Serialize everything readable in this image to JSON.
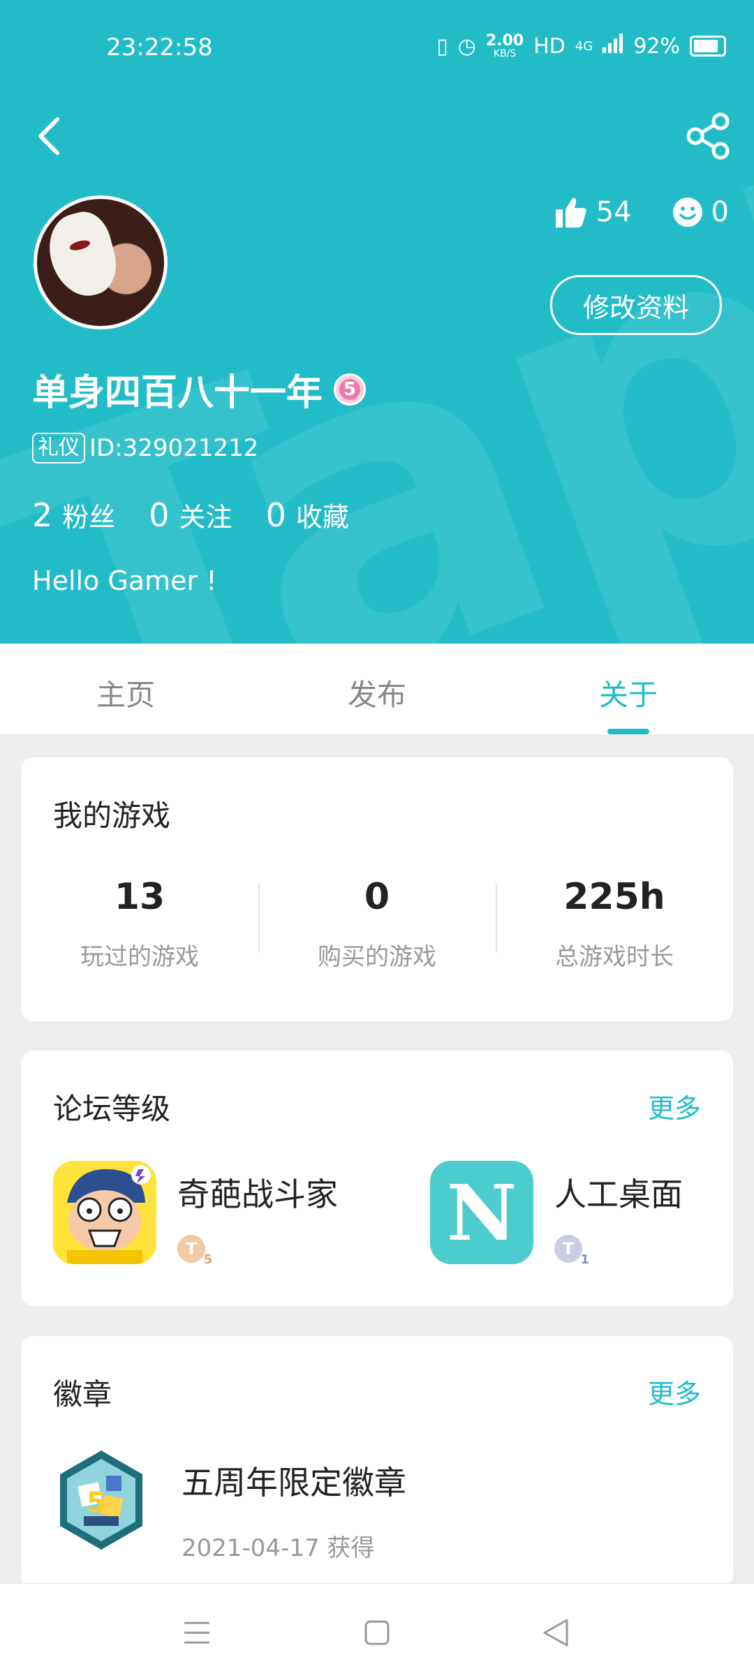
{
  "status_bar": {
    "time": "23:22:58",
    "net_speed": "2.00",
    "net_unit": "KB/S",
    "hd": "HD",
    "network": "4G",
    "battery": "92%"
  },
  "profile": {
    "likes": "54",
    "smiles": "0",
    "edit_label": "修改资料",
    "username": "单身四百八十一年",
    "level": "5",
    "tag": "礼仪",
    "id_text": "ID:329021212",
    "followers_count": "2",
    "followers_label": "粉丝",
    "following_count": "0",
    "following_label": "关注",
    "favorites_count": "0",
    "favorites_label": "收藏",
    "bio": "Hello Gamer !"
  },
  "tabs": [
    {
      "label": "主页"
    },
    {
      "label": "发布"
    },
    {
      "label": "关于"
    }
  ],
  "my_games": {
    "title": "我的游戏",
    "stats": [
      {
        "value": "13",
        "label": "玩过的游戏"
      },
      {
        "value": "0",
        "label": "购买的游戏"
      },
      {
        "value": "225h",
        "label": "总游戏时长"
      }
    ]
  },
  "forum_level": {
    "title": "论坛等级",
    "more": "更多",
    "items": [
      {
        "name": "奇葩战斗家",
        "tier": "T",
        "tier_num": "5"
      },
      {
        "name": "人工桌面",
        "icon_letter": "N",
        "tier": "T",
        "tier_num": "1"
      }
    ]
  },
  "badges": {
    "title": "徽章",
    "more": "更多",
    "items": [
      {
        "name": "五周年限定徽章",
        "date": "2021-04-17 获得"
      }
    ]
  },
  "colors": {
    "accent": "#22bcc8"
  }
}
